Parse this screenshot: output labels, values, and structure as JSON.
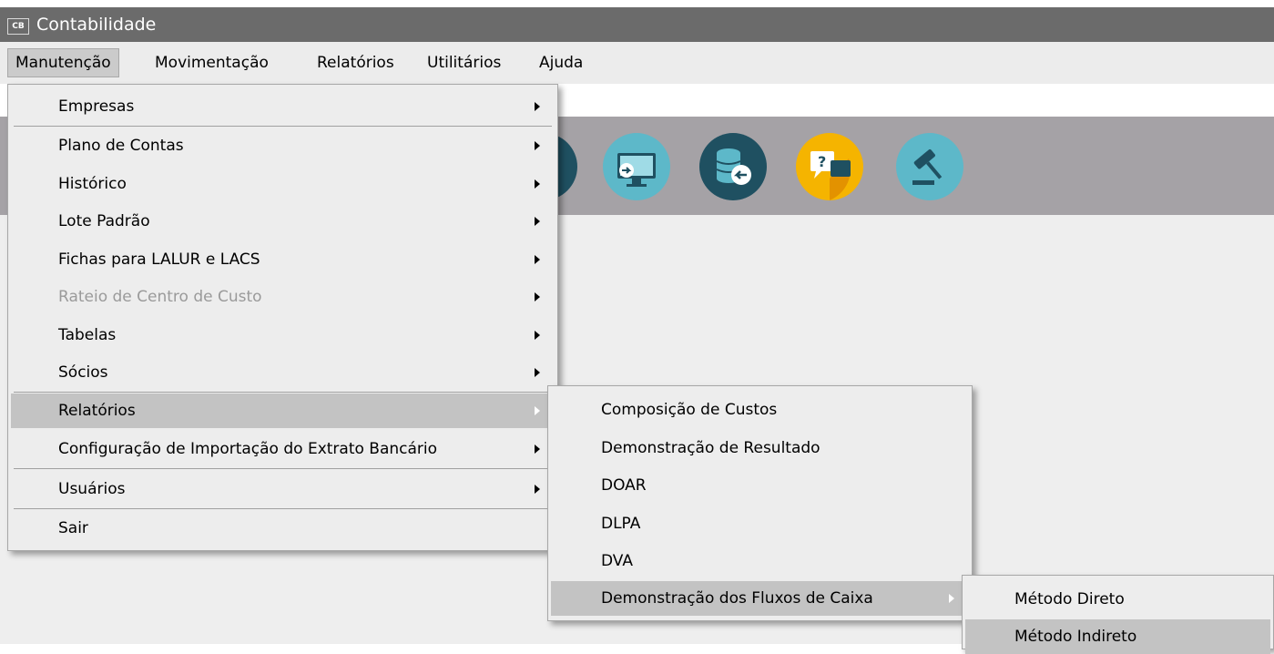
{
  "window": {
    "app_icon_text": "CB",
    "title": "Contabilidade"
  },
  "menubar": {
    "items": [
      "Manutenção",
      "Movimentação",
      "Relatórios",
      "Utilitários",
      "Ajuda"
    ],
    "active": "Manutenção"
  },
  "toolbar": {
    "icons": [
      {
        "name": "monitor-arrow-icon",
        "color": "#5db8c9"
      },
      {
        "name": "database-arrow-icon",
        "color": "#1f5061"
      },
      {
        "name": "help-chat-icon",
        "color": "#f5b400"
      },
      {
        "name": "gavel-icon",
        "color": "#5db8c9"
      }
    ]
  },
  "manutencao_menu": {
    "items": [
      "Empresas",
      "Plano de Contas",
      "Histórico",
      "Lote Padrão",
      "Fichas para LALUR e LACS",
      "Rateio de Centro de Custo",
      "Tabelas",
      "Sócios",
      "Relatórios",
      "Configuração de Importação do Extrato Bancário",
      "Usuários",
      "Sair"
    ]
  },
  "relatorios_menu": {
    "items": [
      "Composição de Custos",
      "Demonstração de Resultado",
      "DOAR",
      "DLPA",
      "DVA",
      "Demonstração dos Fluxos de Caixa"
    ]
  },
  "fluxos_menu": {
    "items": [
      "Método Direto",
      "Método Indireto"
    ]
  }
}
